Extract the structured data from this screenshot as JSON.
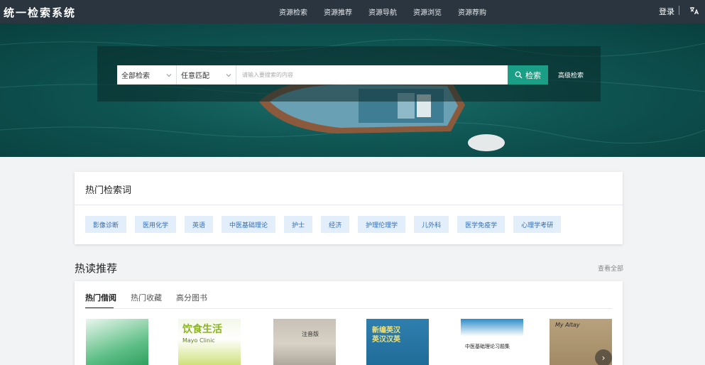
{
  "header": {
    "brand": "统一检索系统",
    "nav": [
      "资源检索",
      "资源推荐",
      "资源导航",
      "资源浏览",
      "资源荐购"
    ],
    "login": "登录"
  },
  "search": {
    "scope": "全部检索",
    "match": "任意匹配",
    "placeholder": "请输入要搜索的内容",
    "button": "检索",
    "advanced": "高级检索"
  },
  "hot_terms": {
    "title": "热门检索词",
    "tags": [
      "影像诊断",
      "医用化学",
      "英语",
      "中医基础理论",
      "护士",
      "经济",
      "护理伦理学",
      "儿外科",
      "医学免疫学",
      "心理学考研"
    ]
  },
  "recommend": {
    "title": "热读推荐",
    "see_all": "查看全部",
    "tabs": [
      "热门借阅",
      "热门收藏",
      "高分图书"
    ],
    "books": {
      "b2_title": "饮食生活",
      "b2_sub": "Mayo Clinic",
      "b3_title": "注音版",
      "b4_title": "新编英汉英汉汉英",
      "b5_title": "中医基础理论习题集",
      "b6_title": "My Altay"
    }
  },
  "colors": {
    "topbar": "#2a3540",
    "accent": "#1a9f86",
    "tag_bg": "#e3eefb",
    "tag_text": "#2f6db8"
  }
}
